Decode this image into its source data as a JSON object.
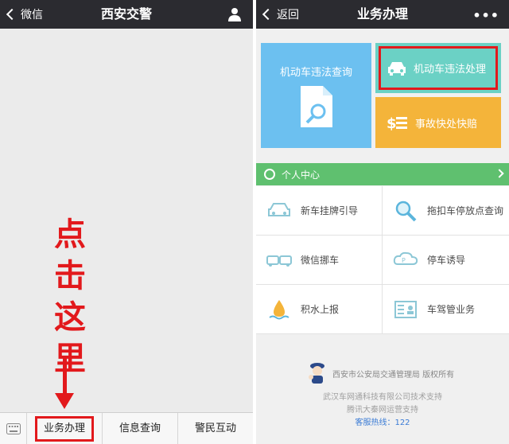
{
  "left": {
    "nav": {
      "back_label": "微信",
      "title": "西安交警"
    },
    "annotation": [
      "点",
      "击",
      "这",
      "里"
    ],
    "tabbar": {
      "tabs": [
        "业务办理",
        "信息查询",
        "警民互动"
      ]
    }
  },
  "right": {
    "nav": {
      "back_label": "返回",
      "title": "业务办理",
      "more": "•••"
    },
    "tiles": {
      "violation_query": "机动车违法查询",
      "violation_handle": "机动车违法处理",
      "accident": "事故快处快赔"
    },
    "section": {
      "label": "个人中心"
    },
    "grid": [
      {
        "label": "新车挂牌引导",
        "icon": "car-icon"
      },
      {
        "label": "拖扣车停放点查询",
        "icon": "magnifier-icon"
      },
      {
        "label": "微信挪车",
        "icon": "cars-icon"
      },
      {
        "label": "停车诱导",
        "icon": "parking-icon"
      },
      {
        "label": "积水上报",
        "icon": "water-drop-icon"
      },
      {
        "label": "车驾管业务",
        "icon": "document-icon"
      }
    ],
    "footer": {
      "org": "西安市公安局交通管理局  版权所有",
      "tech": "武汉车网通科技有限公司技术支持",
      "ops": "腾讯大秦网运营支持",
      "hotline": "客服热线：122"
    }
  },
  "colors": {
    "nav": "#2b2b30",
    "highlight": "#e2191c",
    "blue": "#6cc0f0",
    "teal": "#6bd1c5",
    "orange": "#f4b43a",
    "green": "#5fc06f"
  }
}
